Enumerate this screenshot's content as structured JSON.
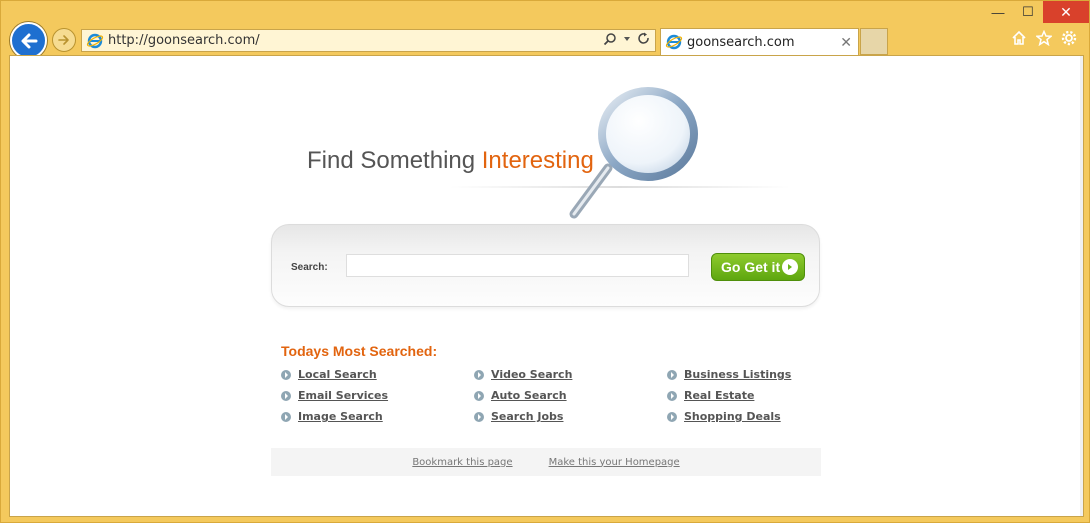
{
  "browser": {
    "url": "http://goonsearch.com/",
    "tab_title": "goonsearch.com",
    "window_controls": {
      "minimize": "—",
      "maximize": "☐",
      "close": "✕"
    }
  },
  "page": {
    "headline_prefix": "Find Something",
    "headline_accent": "Interesting",
    "search_label": "Search:",
    "search_value": "",
    "go_button": "Go Get it",
    "most_searched_title": "Todays Most Searched:",
    "links": [
      "Local Search",
      "Video Search",
      "Business Listings",
      "Email Services",
      "Auto Search",
      "Real Estate",
      "Image Search",
      "Search Jobs",
      "Shopping Deals"
    ],
    "footer": {
      "bookmark": "Bookmark this page",
      "homepage": "Make this your Homepage"
    }
  },
  "colors": {
    "accent": "#e2640f",
    "button_green": "#6bb51a",
    "frame_gold": "#f4c95d",
    "back_blue": "#1e6fd0"
  },
  "icons": [
    "back-arrow-icon",
    "forward-arrow-icon",
    "ie-icon",
    "search-icon",
    "refresh-icon",
    "home-icon",
    "star-icon",
    "gear-icon",
    "close-icon",
    "magnifier-graphic"
  ]
}
